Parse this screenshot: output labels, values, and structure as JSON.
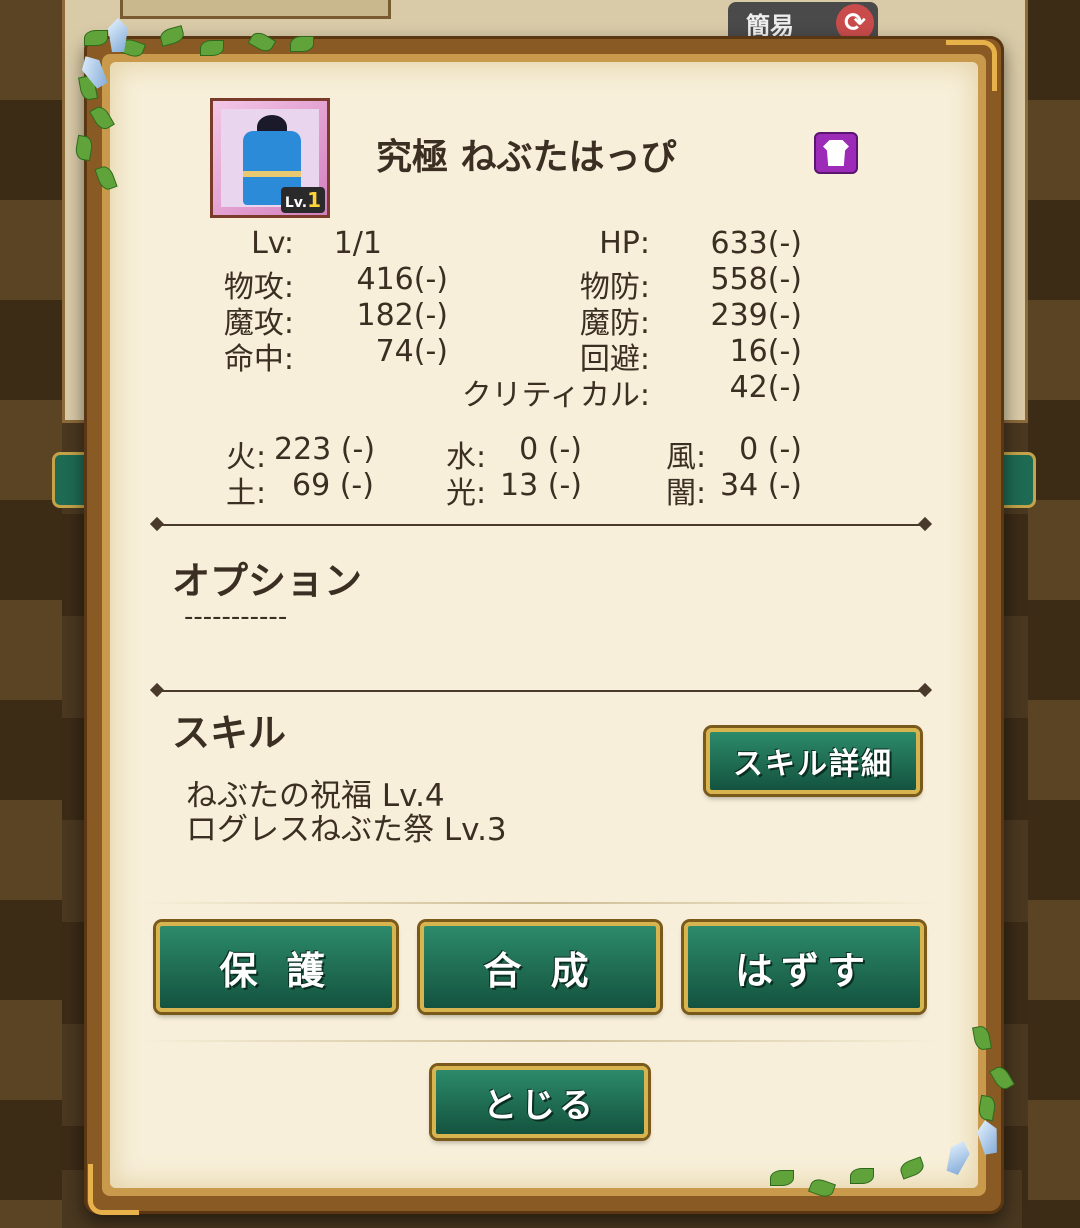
{
  "header": {
    "easy_label": "簡易",
    "refresh_glyph": "⟳"
  },
  "item": {
    "name": "究極 ねぶたはっぴ",
    "level_prefix": "Lv.",
    "level_value": "1"
  },
  "stats": [
    {
      "label": "Lv:",
      "value": "1/1"
    },
    {
      "label": "HP:",
      "value": "633(-)"
    },
    {
      "label": "物攻:",
      "value": "416(-)"
    },
    {
      "label": "物防:",
      "value": "558(-)"
    },
    {
      "label": "魔攻:",
      "value": "182(-)"
    },
    {
      "label": "魔防:",
      "value": "239(-)"
    },
    {
      "label": "命中:",
      "value": "74(-)"
    },
    {
      "label": "回避:",
      "value": "16(-)"
    },
    {
      "label": "クリティカル:",
      "value": "42(-)"
    }
  ],
  "elements": [
    {
      "label": "火:",
      "value": "223 (-)"
    },
    {
      "label": "水:",
      "value": "0 (-)"
    },
    {
      "label": "風:",
      "value": "0 (-)"
    },
    {
      "label": "土:",
      "value": "69 (-)"
    },
    {
      "label": "光:",
      "value": "13 (-)"
    },
    {
      "label": "闇:",
      "value": "34 (-)"
    }
  ],
  "option": {
    "title": "オプション",
    "value": "-----------"
  },
  "skill": {
    "title": "スキル",
    "detail_button": "スキル詳細",
    "list": [
      "ねぶたの祝福  Lv.4",
      "ログレスねぶた祭  Lv.3"
    ]
  },
  "actions": {
    "protect": "保 護",
    "synthesize": "合 成",
    "remove": "はずす",
    "close": "とじる"
  },
  "colors": {
    "button_green": "#1e6f55",
    "button_border": "#d7b44d",
    "panel": "#f7efd9",
    "frame": "#8a5a24"
  }
}
